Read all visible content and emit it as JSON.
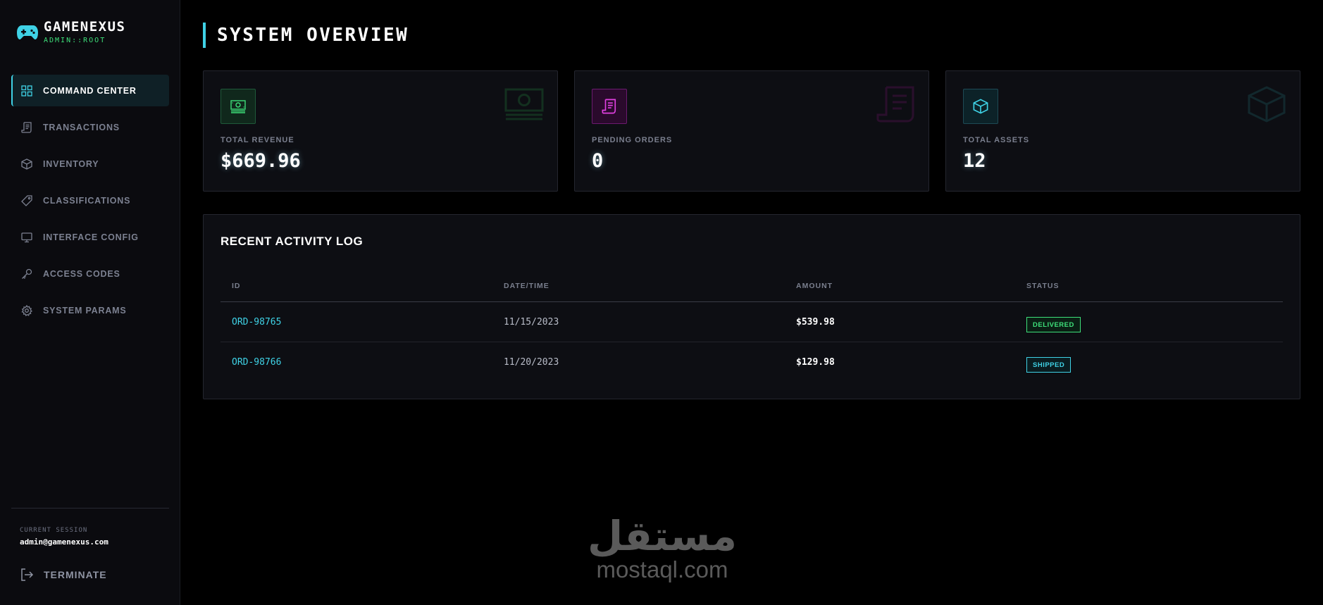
{
  "app": {
    "name": "GAMENEXUS",
    "role": "ADMIN::ROOT",
    "accent": "#3fd2e6",
    "role_color": "#3ee07a"
  },
  "sidebar": {
    "items": [
      {
        "label": "COMMAND CENTER",
        "icon": "grid-icon",
        "active": true
      },
      {
        "label": "TRANSACTIONS",
        "icon": "receipt-icon",
        "active": false
      },
      {
        "label": "INVENTORY",
        "icon": "cube-icon",
        "active": false
      },
      {
        "label": "CLASSIFICATIONS",
        "icon": "tag-icon",
        "active": false
      },
      {
        "label": "INTERFACE CONFIG",
        "icon": "monitor-icon",
        "active": false
      },
      {
        "label": "ACCESS CODES",
        "icon": "key-icon",
        "active": false
      },
      {
        "label": "SYSTEM PARAMS",
        "icon": "gear-icon",
        "active": false
      }
    ],
    "session_label": "CURRENT SESSION",
    "session_user": "admin@gamenexus.com",
    "terminate_label": "TERMINATE"
  },
  "main": {
    "title": "SYSTEM OVERVIEW",
    "cards": [
      {
        "label": "TOTAL REVENUE",
        "value": "$669.96",
        "icon": "cash-icon",
        "color": "#3ee07a"
      },
      {
        "label": "PENDING ORDERS",
        "value": "0",
        "icon": "receipt-icon",
        "color": "#e040e0"
      },
      {
        "label": "TOTAL ASSETS",
        "value": "12",
        "icon": "cube-icon",
        "color": "#3fd2e6"
      }
    ],
    "activity": {
      "title": "RECENT ACTIVITY LOG",
      "columns": [
        "ID",
        "DATE/TIME",
        "AMOUNT",
        "STATUS"
      ],
      "rows": [
        {
          "id": "ORD-98765",
          "date": "11/15/2023",
          "amount": "$539.98",
          "status": "DELIVERED",
          "status_color": "#3ee07a"
        },
        {
          "id": "ORD-98766",
          "date": "11/20/2023",
          "amount": "$129.98",
          "status": "SHIPPED",
          "status_color": "#3fd2e6"
        }
      ]
    }
  },
  "watermark": {
    "arabic": "مستقل",
    "latin": "mostaql.com"
  }
}
